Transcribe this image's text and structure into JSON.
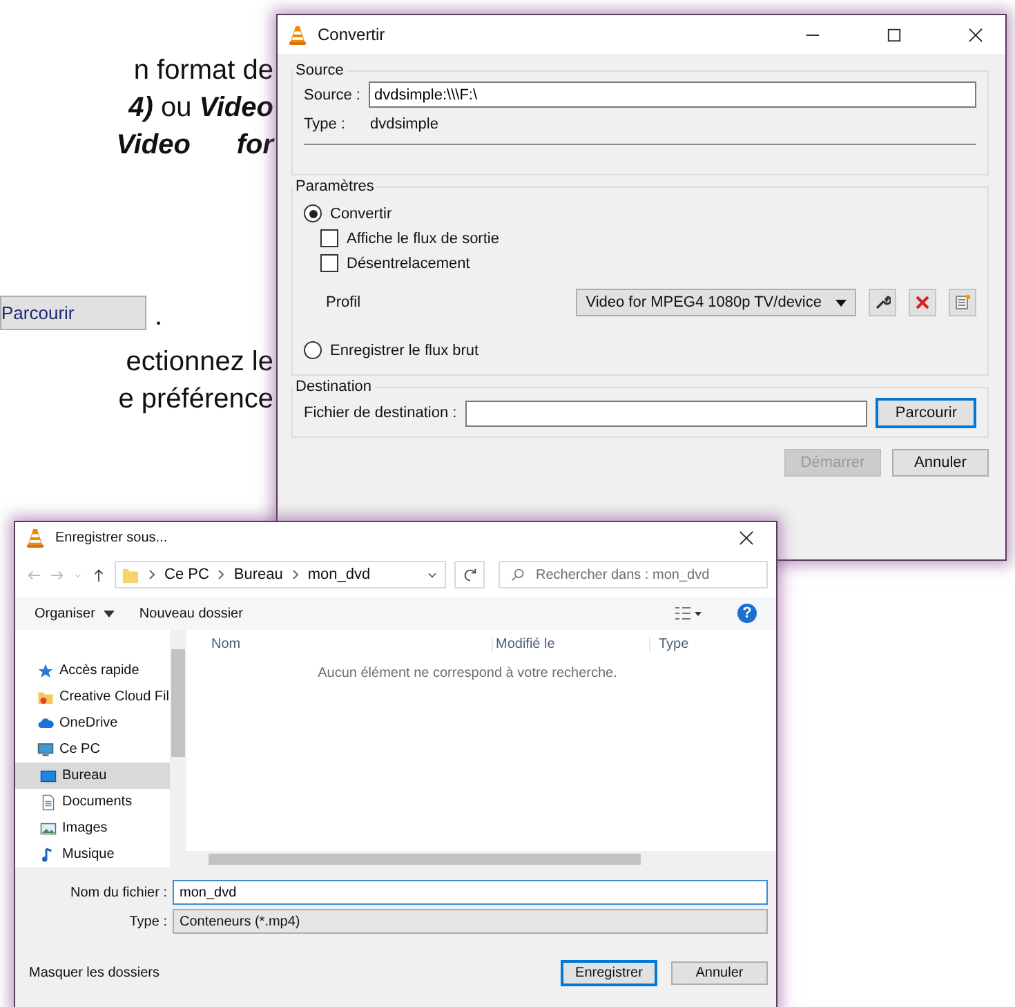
{
  "document": {
    "paragraph_1": [
      [
        {
          "text": "n format de",
          "emphasis": false
        }
      ],
      [
        {
          "text": "4)",
          "emphasis": true
        },
        {
          "text": " ou ",
          "emphasis": false
        },
        {
          "text": "Video",
          "emphasis": true
        }
      ],
      [
        {
          "text": "Video      for",
          "emphasis": true
        }
      ]
    ],
    "button_image": {
      "label": "Parcourir"
    },
    "period": ".",
    "paragraph_2": [
      "ectionnez le",
      "e préférence"
    ]
  },
  "convert_window": {
    "title": "Convertir",
    "source": {
      "legend": "Source",
      "source_label": "Source :",
      "source_value": "dvdsimple:\\\\\\F:\\",
      "type_label": "Type :",
      "type_value": "dvdsimple"
    },
    "parameters": {
      "legend": "Paramètres",
      "options": [
        {
          "kind": "radio",
          "label": "Convertir",
          "selected": true
        },
        {
          "kind": "checkbox",
          "label": "Affiche le flux de sortie",
          "checked": false
        },
        {
          "kind": "checkbox",
          "label": "Désentrelacement",
          "checked": false
        },
        {
          "kind": "profile",
          "label": "Profil",
          "value": "Video for MPEG4 1080p TV/device"
        },
        {
          "kind": "radio",
          "label": "Enregistrer le flux brut",
          "selected": false
        }
      ]
    },
    "destination": {
      "legend": "Destination",
      "label": "Fichier de destination :",
      "button": "Parcourir"
    },
    "buttons": [
      {
        "label": "Démarrer",
        "disabled": true
      },
      {
        "label": "Annuler",
        "disabled": false
      }
    ]
  },
  "save_dialog": {
    "title": "Enregistrer sous...",
    "breadcrumb": [
      "Ce PC",
      "Bureau",
      "mon_dvd"
    ],
    "search": {
      "placeholder": "Rechercher dans : mon_dvd"
    },
    "toolbar": {
      "organize": "Organiser",
      "new_folder": "Nouveau dossier",
      "help": "?"
    },
    "sidebar": {
      "items": [
        {
          "label": "Accès rapide",
          "selected": false
        },
        {
          "label": "Creative Cloud Fil",
          "selected": false
        },
        {
          "label": "OneDrive",
          "selected": false
        },
        {
          "label": "Ce PC",
          "selected": false,
          "children": [
            {
              "label": "Bureau",
              "selected": true
            },
            {
              "label": "Documents",
              "selected": false
            },
            {
              "label": "Images",
              "selected": false
            },
            {
              "label": "Musique",
              "selected": false
            }
          ]
        }
      ]
    },
    "columns": [
      "Nom",
      "Modifié le",
      "Type"
    ],
    "empty_message": "Aucun élément ne correspond à votre recherche.",
    "file_name": {
      "label": "Nom du fichier :",
      "value": "mon_dvd"
    },
    "file_type": {
      "label": "Type :",
      "value": "Conteneurs (*.mp4)"
    },
    "hide_folders": "Masquer les dossiers",
    "buttons": [
      {
        "label": "Enregistrer",
        "default": true
      },
      {
        "label": "Annuler",
        "default": false
      }
    ]
  }
}
